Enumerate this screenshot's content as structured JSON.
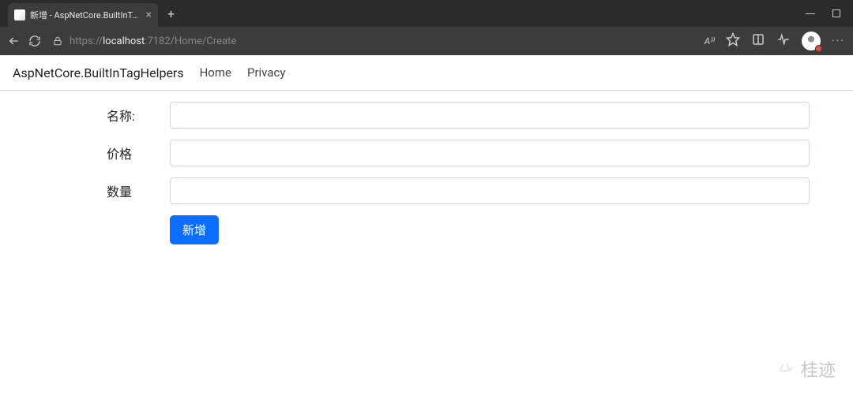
{
  "browser": {
    "tab_title": "新增 - AspNetCore.BuiltInTagHel…",
    "url": {
      "protocol": "https://",
      "host": "localhost",
      "port_and_path": ":7182/Home/Create"
    },
    "read_aloud_label": "A⁾⁾"
  },
  "navbar": {
    "brand": "AspNetCore.BuiltInTagHelpers",
    "links": [
      "Home",
      "Privacy"
    ]
  },
  "form": {
    "fields": [
      {
        "label": "名称:",
        "value": ""
      },
      {
        "label": "价格",
        "value": ""
      },
      {
        "label": "数量",
        "value": ""
      }
    ],
    "submit_label": "新增"
  },
  "watermark": "桂迹"
}
